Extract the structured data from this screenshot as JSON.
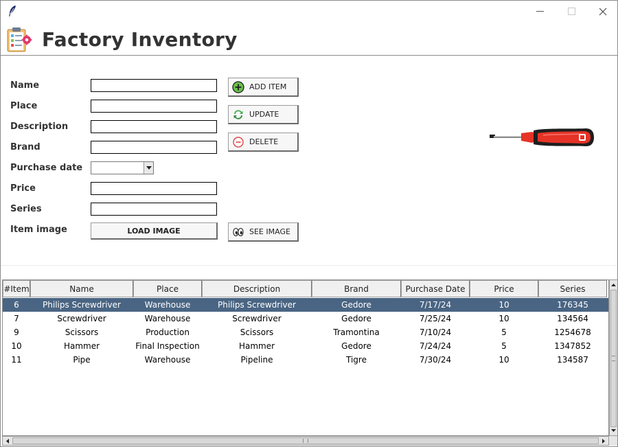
{
  "window": {
    "title": ""
  },
  "header": {
    "title": "Factory Inventory"
  },
  "form": {
    "labels": {
      "name": "Name",
      "place": "Place",
      "description": "Description",
      "brand": "Brand",
      "purchase_date": "Purchase date",
      "price": "Price",
      "series": "Series",
      "item_image": "Item image"
    },
    "values": {
      "name": "",
      "place": "",
      "description": "",
      "brand": "",
      "purchase_date": "",
      "price": "",
      "series": ""
    }
  },
  "buttons": {
    "add_item": "ADD ITEM",
    "update": "UPDATE",
    "delete": "DELETE",
    "load_image": "LOAD IMAGE",
    "see_image": "SEE IMAGE"
  },
  "table": {
    "columns": [
      "#Item",
      "Name",
      "Place",
      "Description",
      "Brand",
      "Purchase Date",
      "Price",
      "Series"
    ],
    "rows": [
      [
        "6",
        "Philips Screwdriver",
        "Warehouse",
        "Philips Screwdriver",
        "Gedore",
        "7/17/24",
        "10",
        "176345"
      ],
      [
        "7",
        "Screwdriver",
        "Warehouse",
        "Screwdriver",
        "Gedore",
        "7/25/24",
        "10",
        "134564"
      ],
      [
        "9",
        "Scissors",
        "Production",
        "Scissors",
        "Tramontina",
        "7/10/24",
        "5",
        "1254678"
      ],
      [
        "10",
        "Hammer",
        "Final Inspection",
        "Hammer",
        "Gedore",
        "7/24/24",
        "5",
        "1347852"
      ],
      [
        "11",
        "Pipe",
        "Warehouse",
        "Pipeline",
        "Tigre",
        "7/30/24",
        "10",
        "134587"
      ]
    ],
    "selected_row": 0
  },
  "colors": {
    "selection": "#4a6583",
    "title_text": "#333333"
  },
  "icons": {
    "app": "clipboard-gear-icon",
    "add": "plus-circle-icon",
    "update": "refresh-icon",
    "delete": "minus-circle-icon",
    "see": "eyes-icon",
    "preview": "screwdriver-image"
  }
}
